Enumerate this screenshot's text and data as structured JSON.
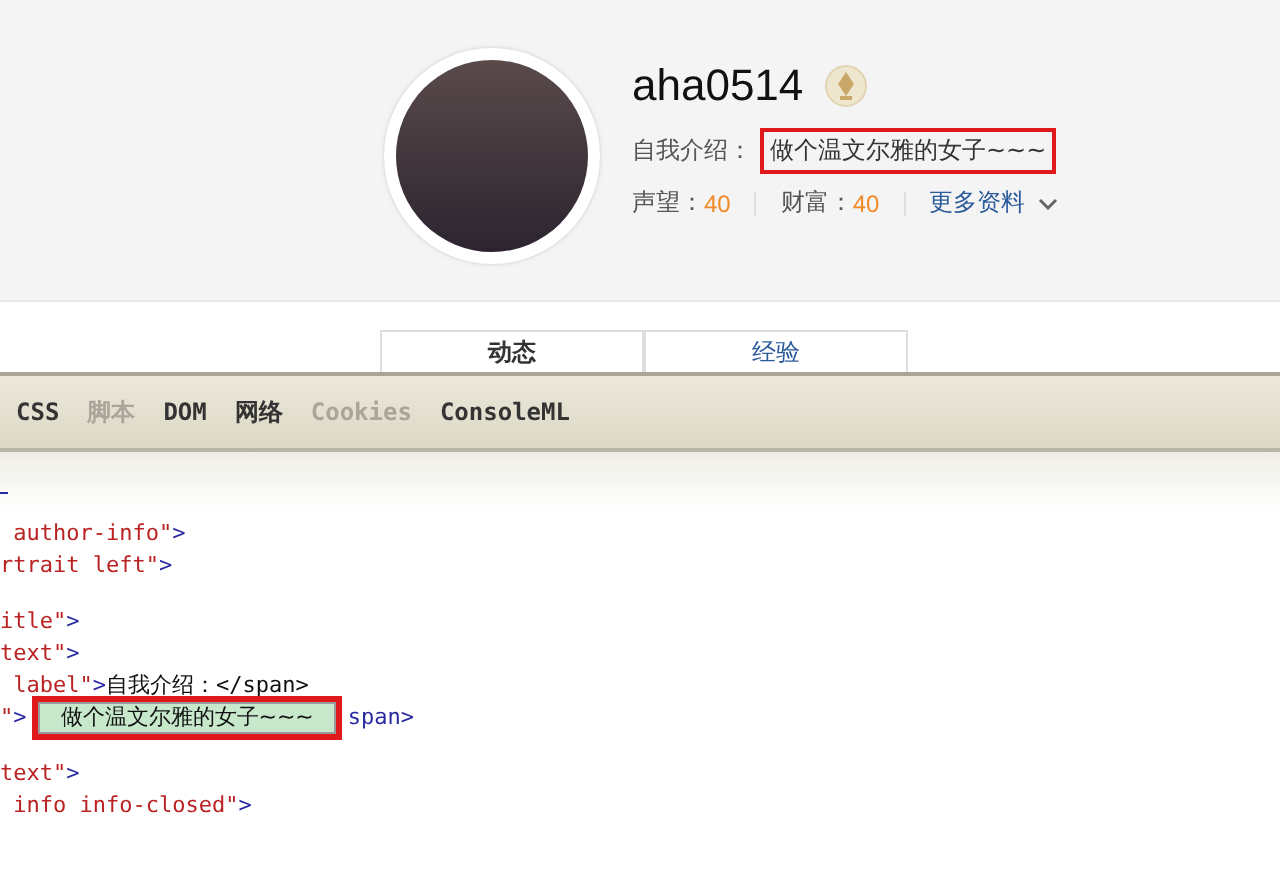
{
  "profile": {
    "username": "aha0514",
    "intro_label": "自我介绍：",
    "intro_value": "做个温文尔雅的女子~~~",
    "intro_marked": true,
    "stats": [
      {
        "label": "声望：",
        "value": "40"
      },
      {
        "label": "财富：",
        "value": "40"
      }
    ],
    "more_link": "更多资料"
  },
  "page_tabs": [
    {
      "label": "动态",
      "selected": true
    },
    {
      "label": "经验",
      "selected": false
    }
  ],
  "devtools": {
    "tabs": [
      {
        "label": "CSS",
        "disabled": false
      },
      {
        "label": "脚本",
        "disabled": true
      },
      {
        "label": "DOM",
        "disabled": false
      },
      {
        "label": "网络",
        "disabled": false
      },
      {
        "label": "Cookies",
        "disabled": true
      },
      {
        "label": "ConsoleML",
        "disabled": false
      }
    ],
    "lines": [
      {
        "parts": [
          {
            "kind": "attr",
            "text": " author-info\""
          },
          {
            "kind": "tag",
            "text": ">"
          }
        ]
      },
      {
        "parts": [
          {
            "kind": "attr",
            "text": "rtrait left\""
          },
          {
            "kind": "tag",
            "text": ">"
          }
        ]
      },
      {
        "kind": "blank"
      },
      {
        "parts": [
          {
            "kind": "attr",
            "text": "itle\""
          },
          {
            "kind": "tag",
            "text": ">"
          }
        ]
      },
      {
        "parts": [
          {
            "kind": "attr",
            "text": "text\""
          },
          {
            "kind": "tag",
            "text": ">"
          }
        ]
      },
      {
        "parts": [
          {
            "kind": "attr",
            "text": " label\""
          },
          {
            "kind": "tag",
            "text": ">"
          },
          {
            "kind": "text",
            "text": "自我介绍：</span>"
          }
        ]
      },
      {
        "parts": [
          {
            "kind": "attr",
            "text": "\""
          },
          {
            "kind": "tag",
            "text": ">"
          },
          {
            "kind": "edit",
            "text": "做个温文尔雅的女子~~~"
          },
          {
            "kind": "tag",
            "text": "span>"
          }
        ]
      },
      {
        "kind": "blank"
      },
      {
        "parts": [
          {
            "kind": "attr",
            "text": "text\""
          },
          {
            "kind": "tag",
            "text": ">"
          }
        ]
      },
      {
        "parts": [
          {
            "kind": "attr",
            "text": " info info-closed\""
          },
          {
            "kind": "tag",
            "text": ">"
          }
        ]
      }
    ]
  }
}
